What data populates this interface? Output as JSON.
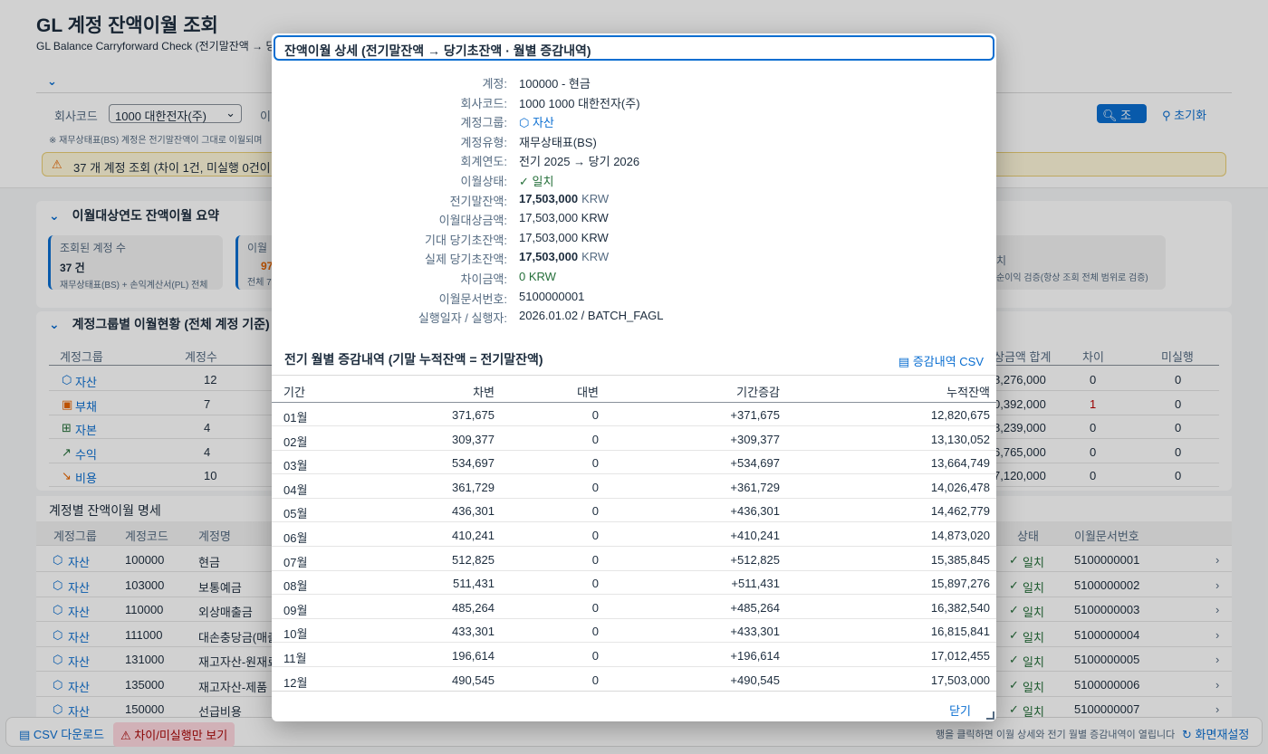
{
  "page": {
    "title": "GL 계정 잔액이월 조회",
    "subtitle": "GL Balance Carryforward Check (전기말잔액 → 당",
    "filter": {
      "company_label": "회사코드",
      "company_value": "1000 대한전자(주)",
      "partial_label": "이",
      "search_label": "조회",
      "reset_label": "초기화"
    },
    "note": "※ 재무상태표(BS) 계정은 전기말잔액이 그대로 이월되며",
    "warning": "37 개 계정 조회 (차이 1건, 미실행 0건이 있",
    "summary": {
      "heading": "이월대상연도 잔액이월 요약",
      "card1": {
        "title": "조회된 계정 수",
        "value": "37 건",
        "sub": "재무상태표(BS) + 손익계산서(PL) 전체"
      },
      "card2": {
        "title": "이월",
        "value": "97",
        "sub": "전체 7"
      },
      "card3": {
        "title": "치",
        "sub": "순이익 검증(항상 조회 전체 범위로 검증)"
      }
    },
    "group_table": {
      "heading": "계정그룹별 이월현황 (전체 계정 기준)",
      "headers": [
        "계정그룹",
        "계정수",
        "상금액 합계",
        "차이",
        "미실행"
      ],
      "rows": [
        {
          "group": "자산",
          "icon": "asset-icon",
          "color": "#0a6ed1",
          "count": "12",
          "sum": "8,276,000",
          "diff": "0",
          "pending": "0"
        },
        {
          "group": "부채",
          "icon": "liability-icon",
          "color": "#e76500",
          "count": "7",
          "sum": "0,392,000",
          "diff": "1",
          "pending": "0"
        },
        {
          "group": "자본",
          "icon": "equity-icon",
          "color": "#256f3a",
          "count": "4",
          "sum": "8,239,000",
          "diff": "0",
          "pending": "0"
        },
        {
          "group": "수익",
          "icon": "revenue-icon",
          "color": "#256f3a",
          "count": "4",
          "sum": "6,765,000",
          "diff": "0",
          "pending": "0"
        },
        {
          "group": "비용",
          "icon": "expense-icon",
          "color": "#e76500",
          "count": "10",
          "sum": "7,120,000",
          "diff": "0",
          "pending": "0"
        }
      ]
    },
    "detail_table": {
      "heading": "계정별 잔액이월 명세",
      "headers": [
        "계정그룹",
        "계정코드",
        "계정명",
        "상태",
        "이월문서번호"
      ],
      "rows": [
        {
          "group": "자산",
          "code": "100000",
          "name": "현금",
          "status": "일치",
          "doc": "5100000001"
        },
        {
          "group": "자산",
          "code": "103000",
          "name": "보통예금",
          "status": "일치",
          "doc": "5100000002"
        },
        {
          "group": "자산",
          "code": "110000",
          "name": "외상매출금",
          "status": "일치",
          "doc": "5100000003"
        },
        {
          "group": "자산",
          "code": "111000",
          "name": "대손충당금(매출",
          "status": "일치",
          "doc": "5100000004"
        },
        {
          "group": "자산",
          "code": "131000",
          "name": "재고자산-원재료",
          "status": "일치",
          "doc": "5100000005"
        },
        {
          "group": "자산",
          "code": "135000",
          "name": "재고자산-제품",
          "status": "일치",
          "doc": "5100000006"
        },
        {
          "group": "자산",
          "code": "150000",
          "name": "선급비용",
          "status": "일치",
          "doc": "5100000007"
        }
      ]
    },
    "footer": {
      "csv_label": "CSV 다운로드",
      "filter_label": "차이/미실행만 보기",
      "hint": "행을 클릭하면 이월 상세와 전기 월별 증감내역이 열립니다",
      "reset_label": "화면재설정"
    }
  },
  "dialog": {
    "title": "잔액이월 상세 (전기말잔액 → 당기초잔액 · 월별 증감내역)",
    "fields": [
      {
        "key": "계정:",
        "value": "100000 - 현금"
      },
      {
        "key": "회사코드:",
        "value": "1000 1000 대한전자(주)"
      },
      {
        "key": "계정그룹:",
        "value": "자산"
      },
      {
        "key": "계정유형:",
        "value": "재무상태표(BS)"
      },
      {
        "key": "회계연도:",
        "value": "전기 2025 → 당기 2026"
      },
      {
        "key": "이월상태:",
        "value": "일치"
      },
      {
        "key": "전기말잔액:",
        "value": "17,503,000",
        "unit": "KRW"
      },
      {
        "key": "이월대상금액:",
        "value": "17,503,000 KRW"
      },
      {
        "key": "기대 당기초잔액:",
        "value": "17,503,000 KRW"
      },
      {
        "key": "실제 당기초잔액:",
        "value": "17,503,000",
        "unit": "KRW"
      },
      {
        "key": "차이금액:",
        "value": "0 KRW"
      },
      {
        "key": "이월문서번호:",
        "value": "5100000001"
      },
      {
        "key": "실행일자 / 실행자:",
        "value": "2026.01.02 / BATCH_FAGL"
      }
    ],
    "monthly_heading": "전기 월별 증감내역 (기말 누적잔액 = 전기말잔액)",
    "csv_label": "증감내역 CSV",
    "monthly_headers": [
      "기간",
      "차변",
      "대변",
      "기간증감",
      "누적잔액"
    ],
    "monthly_rows": [
      [
        "01월",
        "371,675",
        "0",
        "+371,675",
        "12,820,675"
      ],
      [
        "02월",
        "309,377",
        "0",
        "+309,377",
        "13,130,052"
      ],
      [
        "03월",
        "534,697",
        "0",
        "+534,697",
        "13,664,749"
      ],
      [
        "04월",
        "361,729",
        "0",
        "+361,729",
        "14,026,478"
      ],
      [
        "05월",
        "436,301",
        "0",
        "+436,301",
        "14,462,779"
      ],
      [
        "06월",
        "410,241",
        "0",
        "+410,241",
        "14,873,020"
      ],
      [
        "07월",
        "512,825",
        "0",
        "+512,825",
        "15,385,845"
      ],
      [
        "08월",
        "511,431",
        "0",
        "+511,431",
        "15,897,276"
      ],
      [
        "09월",
        "485,264",
        "0",
        "+485,264",
        "16,382,540"
      ],
      [
        "10월",
        "433,301",
        "0",
        "+433,301",
        "16,815,841"
      ],
      [
        "11월",
        "196,614",
        "0",
        "+196,614",
        "17,012,455"
      ],
      [
        "12월",
        "490,545",
        "0",
        "+490,545",
        "17,503,000"
      ]
    ],
    "close_label": "닫기"
  }
}
